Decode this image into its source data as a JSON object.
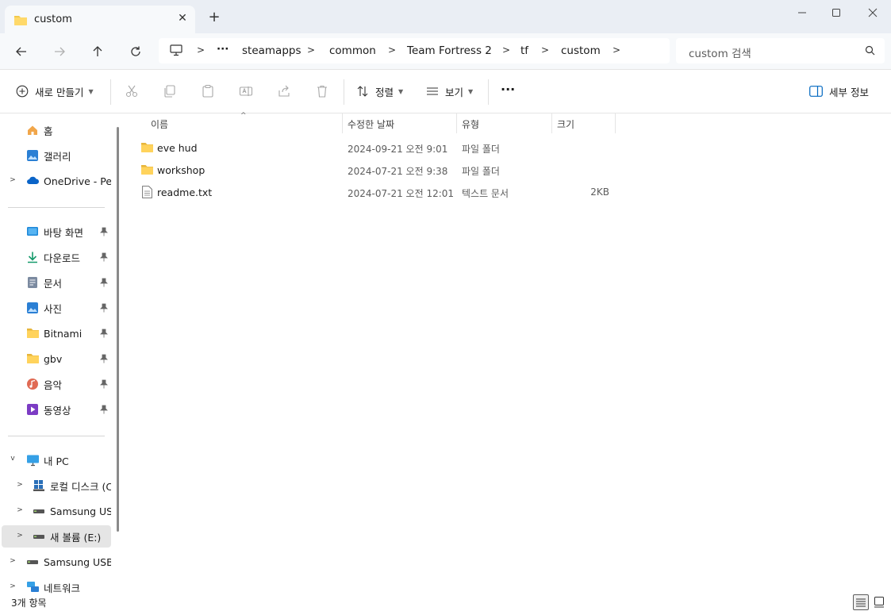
{
  "window": {
    "tab_title": "custom",
    "new_tab_symbol": "+",
    "close_tab_symbol": "✕"
  },
  "nav": {
    "breadcrumbs": [
      "steamapps",
      "common",
      "Team Fortress 2",
      "tf",
      "custom"
    ],
    "overflow": "···",
    "search_placeholder": "custom 검색"
  },
  "commands": {
    "new": "새로 만들기",
    "sort": "정렬",
    "view": "보기",
    "more": "···",
    "details": "세부 정보"
  },
  "sidebar": {
    "home": "홈",
    "gallery": "갤러리",
    "onedrive": "OneDrive - Pers",
    "desktop": "바탕 화면",
    "downloads": "다운로드",
    "documents": "문서",
    "pictures": "사진",
    "bitnami": "Bitnami",
    "gbv": "gbv",
    "music": "음악",
    "videos": "동영상",
    "this_pc": "내 PC",
    "local_disk": "로컬 디스크 (C",
    "samsung_usb_1": "Samsung USB",
    "new_volume": "새 볼륨 (E:)",
    "samsung_usb_2": "Samsung USB (",
    "network": "네트워크"
  },
  "columns": {
    "name": "이름",
    "modified": "수정한 날짜",
    "type": "유형",
    "size": "크기"
  },
  "files": [
    {
      "name": "eve hud",
      "date": "2024-09-21 오전 9:01",
      "type": "파일 폴더",
      "size": "",
      "icon": "folder-icon"
    },
    {
      "name": "workshop",
      "date": "2024-07-21 오전 9:38",
      "type": "파일 폴더",
      "size": "",
      "icon": "folder-icon"
    },
    {
      "name": "readme.txt",
      "date": "2024-07-21 오전 12:01",
      "type": "텍스트 문서",
      "size": "2KB",
      "icon": "text-file-icon"
    }
  ],
  "status": {
    "item_count": "3개 항목"
  },
  "colors": {
    "titlebar_bg": "#eaeef4",
    "folder_yellow": "#f2c94c",
    "selected_bg": "#e5e5e5",
    "accent_blue": "#0067c0"
  }
}
